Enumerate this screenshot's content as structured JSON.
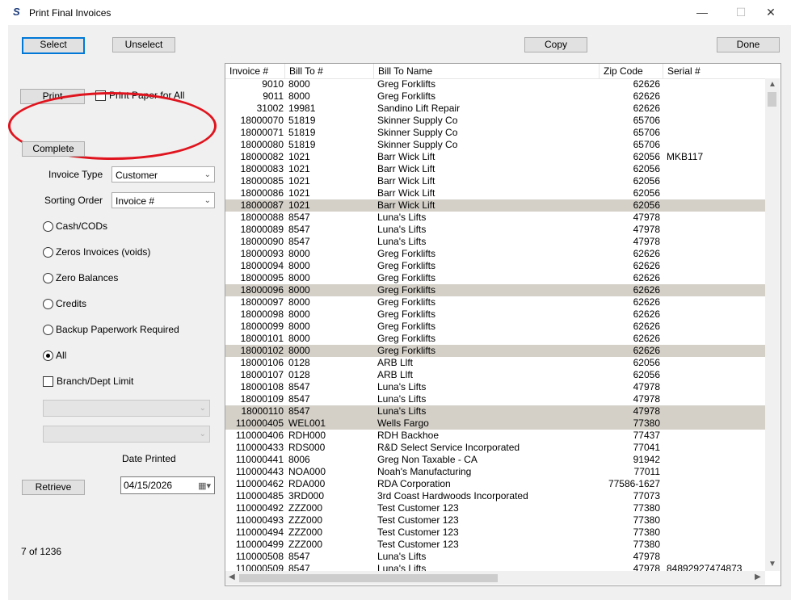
{
  "window": {
    "title": "Print Final Invoices",
    "icon": "S",
    "minimize": "—",
    "maximize": "☐",
    "close": "✕"
  },
  "toolbar": {
    "select": "Select",
    "unselect": "Unselect",
    "copy": "Copy",
    "done": "Done"
  },
  "print": {
    "button": "Print",
    "paper_all": "Print Paper for All",
    "complete": "Complete"
  },
  "filters": {
    "invoice_type_label": "Invoice Type",
    "invoice_type_value": "Customer",
    "sorting_label": "Sorting Order",
    "sorting_value": "Invoice #",
    "options": [
      "Cash/CODs",
      "Zeros Invoices (voids)",
      "Zero Balances",
      "Credits",
      "Backup Paperwork Required",
      "All"
    ],
    "selected_option": "All",
    "branch_limit": "Branch/Dept Limit",
    "date_printed_label": "Date Printed",
    "date_value": "04/15/2026",
    "retrieve": "Retrieve",
    "count": "7 of 1236"
  },
  "grid": {
    "columns": [
      "Invoice #",
      "Bill To #",
      "Bill To Name",
      "Zip Code",
      "Serial #"
    ],
    "rows": [
      {
        "inv": "9010",
        "bill": "8000",
        "name": "Greg Forklifts",
        "zip": "62626",
        "serial": "",
        "sel": false
      },
      {
        "inv": "9011",
        "bill": "8000",
        "name": "Greg Forklifts",
        "zip": "62626",
        "serial": "",
        "sel": false
      },
      {
        "inv": "31002",
        "bill": "19981",
        "name": "Sandino Lift Repair",
        "zip": "62626",
        "serial": "",
        "sel": false
      },
      {
        "inv": "18000070",
        "bill": "51819",
        "name": "Skinner Supply Co",
        "zip": "65706",
        "serial": "",
        "sel": false
      },
      {
        "inv": "18000071",
        "bill": "51819",
        "name": "Skinner Supply Co",
        "zip": "65706",
        "serial": "",
        "sel": false
      },
      {
        "inv": "18000080",
        "bill": "51819",
        "name": "Skinner Supply Co",
        "zip": "65706",
        "serial": "",
        "sel": false
      },
      {
        "inv": "18000082",
        "bill": "1021",
        "name": "Barr Wick Lift",
        "zip": "62056",
        "serial": "MKB117",
        "sel": false
      },
      {
        "inv": "18000083",
        "bill": "1021",
        "name": "Barr Wick Lift",
        "zip": "62056",
        "serial": "",
        "sel": false
      },
      {
        "inv": "18000085",
        "bill": "1021",
        "name": "Barr Wick Lift",
        "zip": "62056",
        "serial": "",
        "sel": false
      },
      {
        "inv": "18000086",
        "bill": "1021",
        "name": "Barr Wick Lift",
        "zip": "62056",
        "serial": "",
        "sel": false
      },
      {
        "inv": "18000087",
        "bill": "1021",
        "name": "Barr Wick Lift",
        "zip": "62056",
        "serial": "",
        "sel": true
      },
      {
        "inv": "18000088",
        "bill": "8547",
        "name": "Luna's Lifts",
        "zip": "47978",
        "serial": "",
        "sel": false
      },
      {
        "inv": "18000089",
        "bill": "8547",
        "name": "Luna's Lifts",
        "zip": "47978",
        "serial": "",
        "sel": false
      },
      {
        "inv": "18000090",
        "bill": "8547",
        "name": "Luna's Lifts",
        "zip": "47978",
        "serial": "",
        "sel": false
      },
      {
        "inv": "18000093",
        "bill": "8000",
        "name": "Greg Forklifts",
        "zip": "62626",
        "serial": "",
        "sel": false
      },
      {
        "inv": "18000094",
        "bill": "8000",
        "name": "Greg Forklifts",
        "zip": "62626",
        "serial": "",
        "sel": false
      },
      {
        "inv": "18000095",
        "bill": "8000",
        "name": "Greg Forklifts",
        "zip": "62626",
        "serial": "",
        "sel": false
      },
      {
        "inv": "18000096",
        "bill": "8000",
        "name": "Greg Forklifts",
        "zip": "62626",
        "serial": "",
        "sel": true
      },
      {
        "inv": "18000097",
        "bill": "8000",
        "name": "Greg Forklifts",
        "zip": "62626",
        "serial": "",
        "sel": false
      },
      {
        "inv": "18000098",
        "bill": "8000",
        "name": "Greg Forklifts",
        "zip": "62626",
        "serial": "",
        "sel": false
      },
      {
        "inv": "18000099",
        "bill": "8000",
        "name": "Greg Forklifts",
        "zip": "62626",
        "serial": "",
        "sel": false
      },
      {
        "inv": "18000101",
        "bill": "8000",
        "name": "Greg Forklifts",
        "zip": "62626",
        "serial": "",
        "sel": false
      },
      {
        "inv": "18000102",
        "bill": "8000",
        "name": "Greg Forklifts",
        "zip": "62626",
        "serial": "",
        "sel": true
      },
      {
        "inv": "18000106",
        "bill": "0128",
        "name": "ARB Llft",
        "zip": "62056",
        "serial": "",
        "sel": false
      },
      {
        "inv": "18000107",
        "bill": "0128",
        "name": "ARB Llft",
        "zip": "62056",
        "serial": "",
        "sel": false
      },
      {
        "inv": "18000108",
        "bill": "8547",
        "name": "Luna's Lifts",
        "zip": "47978",
        "serial": "",
        "sel": false
      },
      {
        "inv": "18000109",
        "bill": "8547",
        "name": "Luna's Lifts",
        "zip": "47978",
        "serial": "",
        "sel": false
      },
      {
        "inv": "18000110",
        "bill": "8547",
        "name": "Luna's Lifts",
        "zip": "47978",
        "serial": "",
        "sel": true
      },
      {
        "inv": "110000405",
        "bill": "WEL001",
        "name": "Wells Fargo",
        "zip": "77380",
        "serial": "",
        "sel": true
      },
      {
        "inv": "110000406",
        "bill": "RDH000",
        "name": "RDH Backhoe",
        "zip": "77437",
        "serial": "",
        "sel": false
      },
      {
        "inv": "110000433",
        "bill": "RDS000",
        "name": "R&D Select Service Incorporated",
        "zip": "77041",
        "serial": "",
        "sel": false
      },
      {
        "inv": "110000441",
        "bill": "8006",
        "name": "Greg Non Taxable - CA",
        "zip": "91942",
        "serial": "",
        "sel": false
      },
      {
        "inv": "110000443",
        "bill": "NOA000",
        "name": "Noah's Manufacturing",
        "zip": "77011",
        "serial": "",
        "sel": false
      },
      {
        "inv": "110000462",
        "bill": "RDA000",
        "name": "RDA Corporation",
        "zip": "77586-1627",
        "serial": "",
        "sel": false
      },
      {
        "inv": "110000485",
        "bill": "3RD000",
        "name": "3rd Coast Hardwoods Incorporated",
        "zip": "77073",
        "serial": "",
        "sel": false
      },
      {
        "inv": "110000492",
        "bill": "ZZZ000",
        "name": "Test Customer 123",
        "zip": "77380",
        "serial": "",
        "sel": false
      },
      {
        "inv": "110000493",
        "bill": "ZZZ000",
        "name": "Test Customer 123",
        "zip": "77380",
        "serial": "",
        "sel": false
      },
      {
        "inv": "110000494",
        "bill": "ZZZ000",
        "name": "Test Customer 123",
        "zip": "77380",
        "serial": "",
        "sel": false
      },
      {
        "inv": "110000499",
        "bill": "ZZZ000",
        "name": "Test Customer 123",
        "zip": "77380",
        "serial": "",
        "sel": false
      },
      {
        "inv": "110000508",
        "bill": "8547",
        "name": "Luna's Lifts",
        "zip": "47978",
        "serial": "",
        "sel": false
      },
      {
        "inv": "110000509",
        "bill": "8547",
        "name": "Luna's Lifts",
        "zip": "47978",
        "serial": "84892927474873",
        "sel": false
      }
    ]
  },
  "colors": {
    "accent": "#0078d7",
    "selected_row": "#d4d0c8",
    "annotation": "#e0141e"
  }
}
